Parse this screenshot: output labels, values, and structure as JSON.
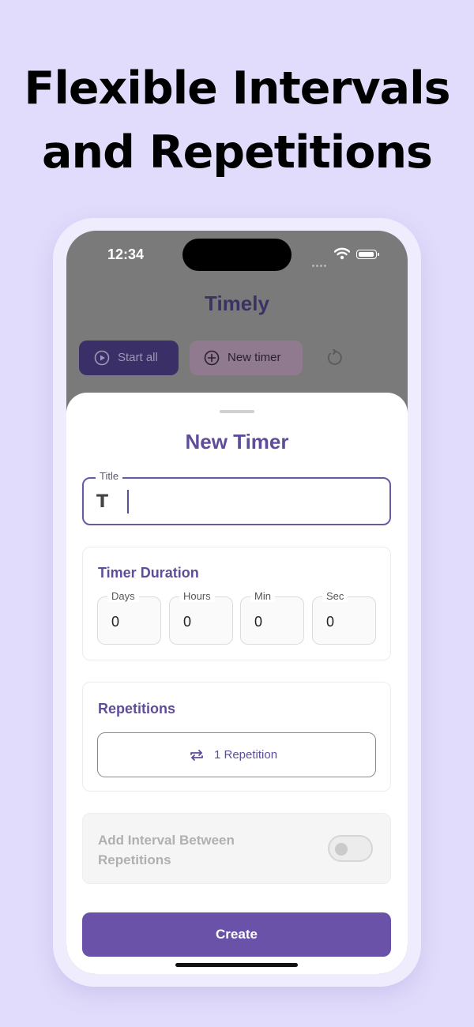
{
  "headline": {
    "line1": "Flexible Intervals",
    "line2": "and Repetitions"
  },
  "status_bar": {
    "time": "12:34"
  },
  "app": {
    "title": "Timely",
    "start_all_label": "Start all",
    "new_timer_label": "New timer"
  },
  "sheet": {
    "title": "New Timer",
    "title_field": {
      "label": "Title",
      "icon_glyph": "T",
      "value": ""
    },
    "duration": {
      "title": "Timer Duration",
      "fields": [
        {
          "label": "Days",
          "value": "0"
        },
        {
          "label": "Hours",
          "value": "0"
        },
        {
          "label": "Min",
          "value": "0"
        },
        {
          "label": "Sec",
          "value": "0"
        }
      ]
    },
    "repetitions": {
      "title": "Repetitions",
      "button_label": "1 Repetition"
    },
    "interval": {
      "label": "Add Interval Between Repetitions",
      "enabled": false
    },
    "create_label": "Create"
  },
  "colors": {
    "accent": "#6a52a8",
    "page_background": "#e1dcfb"
  }
}
